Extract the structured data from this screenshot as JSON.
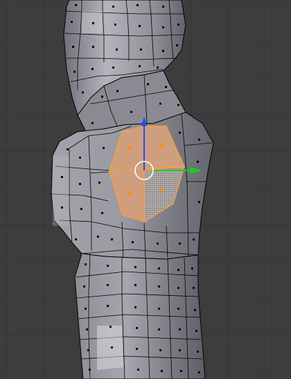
{
  "editor": {
    "mode": "Edit Mode",
    "selection_type": "face",
    "selected_faces": 4
  },
  "colors": {
    "background": "#3d3d3d",
    "grid": "#363636",
    "mesh_face": "#8f8f93",
    "mesh_edge": "#000000",
    "selection_fill": "#d9a070",
    "selection_edge": "#f3a13a",
    "face_dot": "#000000",
    "selected_face_dot": "#ff8c1a",
    "gizmo_x": "#1ecb1e",
    "gizmo_z": "#1a4cff",
    "gizmo_circle": "#ffffff"
  },
  "gizmo": {
    "type": "translate",
    "axes": [
      "x",
      "z"
    ]
  }
}
